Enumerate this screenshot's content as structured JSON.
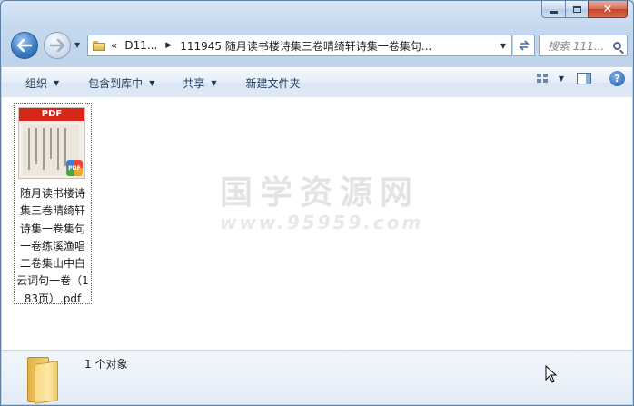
{
  "window": {
    "minimize_label": "",
    "maximize_label": "",
    "close_label": "✕"
  },
  "address": {
    "breadcrumbs": [
      "«",
      "D11...",
      "111945 随月读书楼诗集三卷晴绮轩诗集一卷集句..."
    ],
    "search_placeholder": "搜索 111..."
  },
  "toolbar": {
    "organize": "组织",
    "include_in_library": "包含到库中",
    "share": "共享",
    "new_folder": "新建文件夹",
    "help": "?"
  },
  "file": {
    "thumb_label": "PDF",
    "badge_label": "PDF",
    "name": "随月读书楼诗集三卷晴绮轩诗集一卷集句一卷练溪渔唱二卷集山中白云词句一卷（183页）.pdf"
  },
  "watermark": {
    "main": "国学资源网",
    "sub": "www.95959.com"
  },
  "status": {
    "count": "1 个对象"
  },
  "colors": {
    "accent": "#3f7fc8",
    "pdf_red": "#d7271b",
    "close_red": "#c2442c"
  }
}
